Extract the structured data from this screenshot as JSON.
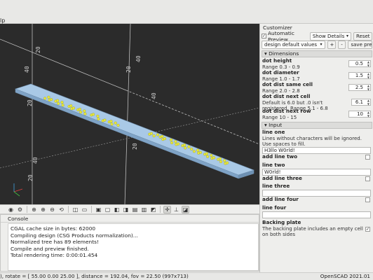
{
  "topbar": {
    "menu_fragment": "lp"
  },
  "viewport": {
    "axis_labels": [
      "20",
      "40",
      "20",
      "40",
      "20",
      "40",
      "20",
      "40",
      "20"
    ],
    "colors": {
      "background": "#2b2b2b",
      "plate": "#9cc0df",
      "dot": "#e8e83a"
    }
  },
  "toolbar": {
    "icons": [
      "preview-icon",
      "render-icon",
      "view-all-icon",
      "zoom-in-icon",
      "zoom-out-icon",
      "reset-view-icon",
      "perspective-icon",
      "orthogonal-icon",
      "top-view-icon",
      "bottom-view-icon",
      "left-view-icon",
      "right-view-icon",
      "front-view-icon",
      "back-view-icon",
      "diagonal-view-icon",
      "axes-icon",
      "scale-icon",
      "edges-icon"
    ],
    "glyphs": [
      "◉",
      "⚙",
      "⊕",
      "⊕",
      "⊖",
      "⟲",
      "◫",
      "▭",
      "▣",
      "▢",
      "◧",
      "◨",
      "▤",
      "▥",
      "◩",
      "✛",
      "⊥",
      "◪"
    ]
  },
  "console": {
    "title": "Console",
    "lines": [
      "CGAL cache size in bytes: 62000",
      "Compiling design (CSG Products normalization)...",
      "Normalized tree has 89 elements!",
      "Compile and preview finished.",
      "Total rendering time: 0:00:01.454"
    ]
  },
  "status": {
    "left": "), rotate = [ 55.00 0.00 25.00 ], distance = 192.04, fov = 22.50 (997x713)",
    "right": "OpenSCAD 2021.01"
  },
  "customizer": {
    "title": "Customizer",
    "auto_preview_label": "Automatic Preview",
    "auto_preview_checked": "✓",
    "show_details_label": "Show Details",
    "reset_label": "Reset",
    "preset_value": "design default values",
    "add_preset_label": "+",
    "remove_preset_label": "-",
    "save_preset_label": "save preset",
    "dimensions": {
      "header": "Dimensions",
      "params": [
        {
          "name": "dot height",
          "desc": "Range 0.3 - 0.9",
          "value": "0.5"
        },
        {
          "name": "dot diameter",
          "desc": "Range 1.0 - 1.7",
          "value": "1.5"
        },
        {
          "name": "dot dist same cell",
          "desc": "Range 2.0 - 2.8",
          "value": "2.5"
        },
        {
          "name": "dot dist next cell",
          "desc": "Default is 6.0 but .0 isn't registered. Range 5.1 - 6.8",
          "value": "6.1"
        },
        {
          "name": "dot dist next row",
          "desc": "Range 10 - 15",
          "value": "10"
        }
      ]
    },
    "input": {
      "header": "Input",
      "line_one": {
        "name": "line one",
        "desc": "Lines without characters will be ignored.  Use spaces to fill.",
        "value": "H3llo W0rld!"
      },
      "add_line_two": {
        "name": "add line two"
      },
      "line_two": {
        "name": "line two",
        "value": "W0rld!"
      },
      "add_line_three": {
        "name": "add line three"
      },
      "line_three": {
        "name": "line three",
        "value": ""
      },
      "add_line_four": {
        "name": "add line four"
      },
      "line_four": {
        "name": "line four",
        "value": ""
      },
      "backing_plate": {
        "name": "Backing plate",
        "desc": "The backing plate includes an empty cell on both sides",
        "checked": "✓"
      }
    }
  }
}
